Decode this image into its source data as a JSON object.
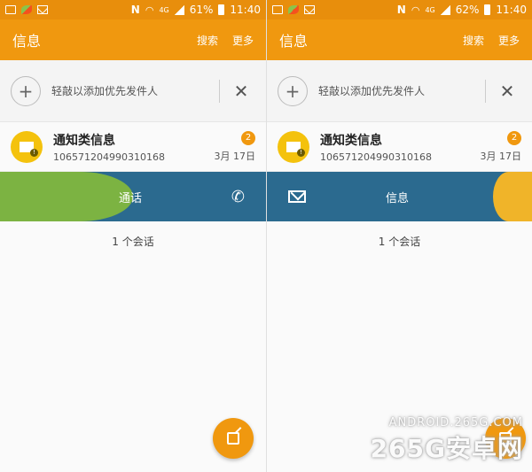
{
  "left": {
    "status": {
      "network": "4G",
      "battery": "61%",
      "time": "11:40"
    },
    "appbar": {
      "title": "信息",
      "search": "搜索",
      "more": "更多"
    },
    "recipient": {
      "placeholder": "轻敲以添加优先发件人"
    },
    "conversation": {
      "name": "通知类信息",
      "number": "106571204990310168",
      "badge": "2",
      "date": "3月 17日"
    },
    "swipe": {
      "label": "通话"
    },
    "count": "1 个会话"
  },
  "right": {
    "status": {
      "network": "4G",
      "battery": "62%",
      "time": "11:40"
    },
    "appbar": {
      "title": "信息",
      "search": "搜索",
      "more": "更多"
    },
    "recipient": {
      "placeholder": "轻敲以添加优先发件人"
    },
    "conversation": {
      "name": "通知类信息",
      "number": "106571204990310168",
      "badge": "2",
      "date": "3月 17日"
    },
    "swipe": {
      "label": "信息"
    },
    "count": "1 个会话"
  },
  "watermark": {
    "line1": "ANDROID.265G.COM",
    "line2": "265G安卓网"
  },
  "colors": {
    "accent": "#f0980f",
    "call_green": "#7cb342",
    "swipe_blue": "#2b6a8f",
    "avatar_yellow": "#f4c20d"
  }
}
